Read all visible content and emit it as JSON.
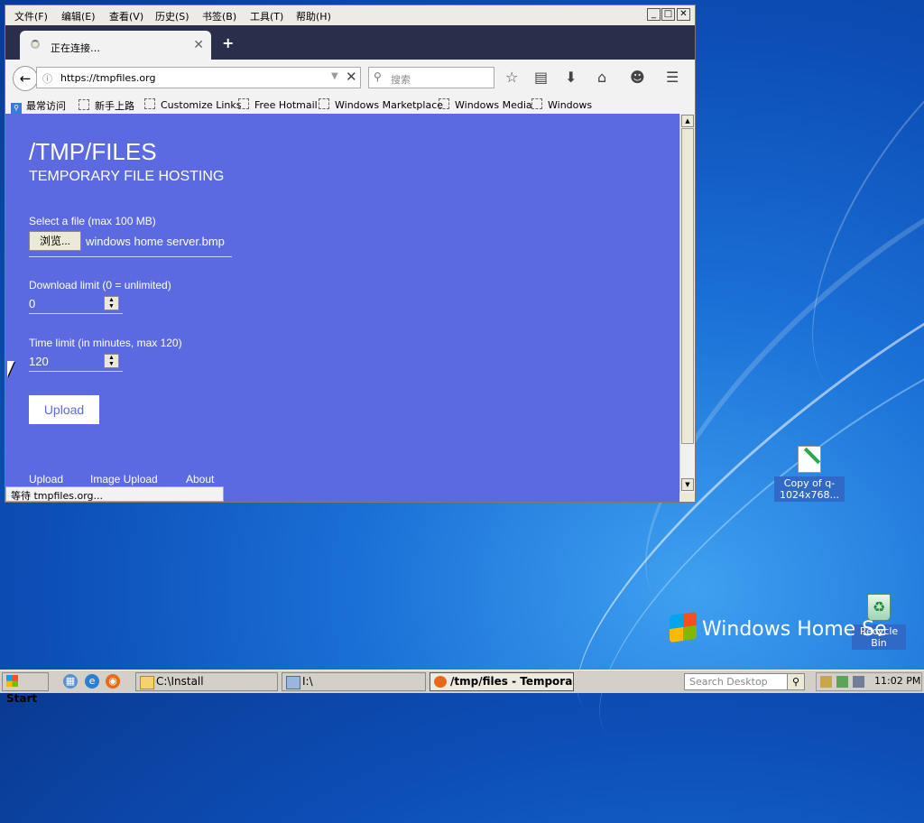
{
  "browser": {
    "menu": [
      "文件(F)",
      "编辑(E)",
      "查看(V)",
      "历史(S)",
      "书签(B)",
      "工具(T)",
      "帮助(H)"
    ],
    "window_controls": {
      "minimize": "_",
      "maximize": "□",
      "close": "✕"
    },
    "tab": {
      "title": "正在连接…",
      "close": "✕",
      "new_tab": "+"
    },
    "url": "https://tmpfiles.org",
    "search_placeholder": "搜索",
    "bookmarks": {
      "most_visited": "最常访问",
      "items": [
        "新手上路",
        "Customize Links",
        "Free Hotmail",
        "Windows Marketplace",
        "Windows Media",
        "Windows"
      ]
    },
    "status": "等待 tmpfiles.org..."
  },
  "page": {
    "title": "/TMP/FILES",
    "subtitle": "TEMPORARY FILE HOSTING",
    "file_label": "Select a file (max 100 MB)",
    "browse_label": "浏览...",
    "file_name": "windows home server.bmp",
    "download_limit_label": "Download limit (0 = unlimited)",
    "download_limit_value": "0",
    "time_limit_label": "Time limit (in minutes, max 120)",
    "time_limit_value": "120",
    "upload_button": "Upload",
    "footer": [
      "Upload",
      "Image Upload",
      "About"
    ]
  },
  "desktop": {
    "icons": [
      {
        "label": "Copy of q-1024x768...",
        "icon": "image-file-icon"
      },
      {
        "label": "Recycle Bin",
        "icon": "recycle-bin-icon"
      }
    ],
    "branding": "Windows Home Se"
  },
  "taskbar": {
    "start": "Start",
    "quick_launch": [
      "show-desktop-icon",
      "internet-explorer-icon",
      "firefox-icon"
    ],
    "tasks": [
      {
        "label": "C:\\Install",
        "active": false
      },
      {
        "label": "I:\\",
        "active": false
      },
      {
        "label": "/tmp/files - Tempora...",
        "active": true
      }
    ],
    "search_placeholder": "Search Desktop",
    "clock": "11:02 PM"
  }
}
